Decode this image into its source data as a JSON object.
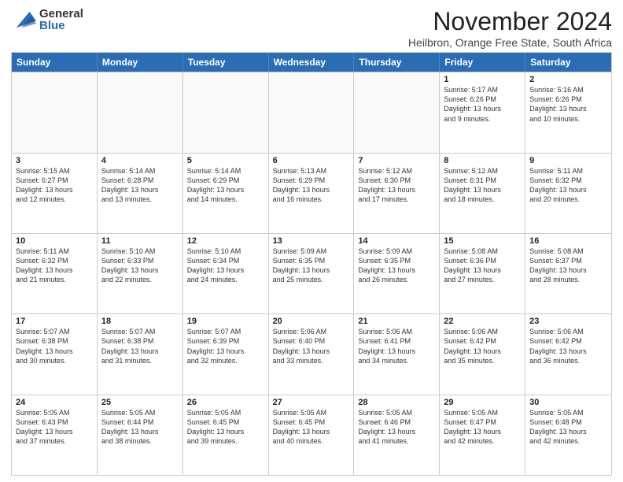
{
  "logo": {
    "general": "General",
    "blue": "Blue"
  },
  "title": "November 2024",
  "location": "Heilbron, Orange Free State, South Africa",
  "header": {
    "days": [
      "Sunday",
      "Monday",
      "Tuesday",
      "Wednesday",
      "Thursday",
      "Friday",
      "Saturday"
    ]
  },
  "weeks": [
    {
      "cells": [
        {
          "day": "",
          "info": ""
        },
        {
          "day": "",
          "info": ""
        },
        {
          "day": "",
          "info": ""
        },
        {
          "day": "",
          "info": ""
        },
        {
          "day": "",
          "info": ""
        },
        {
          "day": "1",
          "info": "Sunrise: 5:17 AM\nSunset: 6:26 PM\nDaylight: 13 hours\nand 9 minutes."
        },
        {
          "day": "2",
          "info": "Sunrise: 5:16 AM\nSunset: 6:26 PM\nDaylight: 13 hours\nand 10 minutes."
        }
      ]
    },
    {
      "cells": [
        {
          "day": "3",
          "info": "Sunrise: 5:15 AM\nSunset: 6:27 PM\nDaylight: 13 hours\nand 12 minutes."
        },
        {
          "day": "4",
          "info": "Sunrise: 5:14 AM\nSunset: 6:28 PM\nDaylight: 13 hours\nand 13 minutes."
        },
        {
          "day": "5",
          "info": "Sunrise: 5:14 AM\nSunset: 6:29 PM\nDaylight: 13 hours\nand 14 minutes."
        },
        {
          "day": "6",
          "info": "Sunrise: 5:13 AM\nSunset: 6:29 PM\nDaylight: 13 hours\nand 16 minutes."
        },
        {
          "day": "7",
          "info": "Sunrise: 5:12 AM\nSunset: 6:30 PM\nDaylight: 13 hours\nand 17 minutes."
        },
        {
          "day": "8",
          "info": "Sunrise: 5:12 AM\nSunset: 6:31 PM\nDaylight: 13 hours\nand 18 minutes."
        },
        {
          "day": "9",
          "info": "Sunrise: 5:11 AM\nSunset: 6:32 PM\nDaylight: 13 hours\nand 20 minutes."
        }
      ]
    },
    {
      "cells": [
        {
          "day": "10",
          "info": "Sunrise: 5:11 AM\nSunset: 6:32 PM\nDaylight: 13 hours\nand 21 minutes."
        },
        {
          "day": "11",
          "info": "Sunrise: 5:10 AM\nSunset: 6:33 PM\nDaylight: 13 hours\nand 22 minutes."
        },
        {
          "day": "12",
          "info": "Sunrise: 5:10 AM\nSunset: 6:34 PM\nDaylight: 13 hours\nand 24 minutes."
        },
        {
          "day": "13",
          "info": "Sunrise: 5:09 AM\nSunset: 6:35 PM\nDaylight: 13 hours\nand 25 minutes."
        },
        {
          "day": "14",
          "info": "Sunrise: 5:09 AM\nSunset: 6:35 PM\nDaylight: 13 hours\nand 26 minutes."
        },
        {
          "day": "15",
          "info": "Sunrise: 5:08 AM\nSunset: 6:36 PM\nDaylight: 13 hours\nand 27 minutes."
        },
        {
          "day": "16",
          "info": "Sunrise: 5:08 AM\nSunset: 6:37 PM\nDaylight: 13 hours\nand 28 minutes."
        }
      ]
    },
    {
      "cells": [
        {
          "day": "17",
          "info": "Sunrise: 5:07 AM\nSunset: 6:38 PM\nDaylight: 13 hours\nand 30 minutes."
        },
        {
          "day": "18",
          "info": "Sunrise: 5:07 AM\nSunset: 6:38 PM\nDaylight: 13 hours\nand 31 minutes."
        },
        {
          "day": "19",
          "info": "Sunrise: 5:07 AM\nSunset: 6:39 PM\nDaylight: 13 hours\nand 32 minutes."
        },
        {
          "day": "20",
          "info": "Sunrise: 5:06 AM\nSunset: 6:40 PM\nDaylight: 13 hours\nand 33 minutes."
        },
        {
          "day": "21",
          "info": "Sunrise: 5:06 AM\nSunset: 6:41 PM\nDaylight: 13 hours\nand 34 minutes."
        },
        {
          "day": "22",
          "info": "Sunrise: 5:06 AM\nSunset: 6:42 PM\nDaylight: 13 hours\nand 35 minutes."
        },
        {
          "day": "23",
          "info": "Sunrise: 5:06 AM\nSunset: 6:42 PM\nDaylight: 13 hours\nand 36 minutes."
        }
      ]
    },
    {
      "cells": [
        {
          "day": "24",
          "info": "Sunrise: 5:05 AM\nSunset: 6:43 PM\nDaylight: 13 hours\nand 37 minutes."
        },
        {
          "day": "25",
          "info": "Sunrise: 5:05 AM\nSunset: 6:44 PM\nDaylight: 13 hours\nand 38 minutes."
        },
        {
          "day": "26",
          "info": "Sunrise: 5:05 AM\nSunset: 6:45 PM\nDaylight: 13 hours\nand 39 minutes."
        },
        {
          "day": "27",
          "info": "Sunrise: 5:05 AM\nSunset: 6:45 PM\nDaylight: 13 hours\nand 40 minutes."
        },
        {
          "day": "28",
          "info": "Sunrise: 5:05 AM\nSunset: 6:46 PM\nDaylight: 13 hours\nand 41 minutes."
        },
        {
          "day": "29",
          "info": "Sunrise: 5:05 AM\nSunset: 6:47 PM\nDaylight: 13 hours\nand 42 minutes."
        },
        {
          "day": "30",
          "info": "Sunrise: 5:05 AM\nSunset: 6:48 PM\nDaylight: 13 hours\nand 42 minutes."
        }
      ]
    }
  ]
}
